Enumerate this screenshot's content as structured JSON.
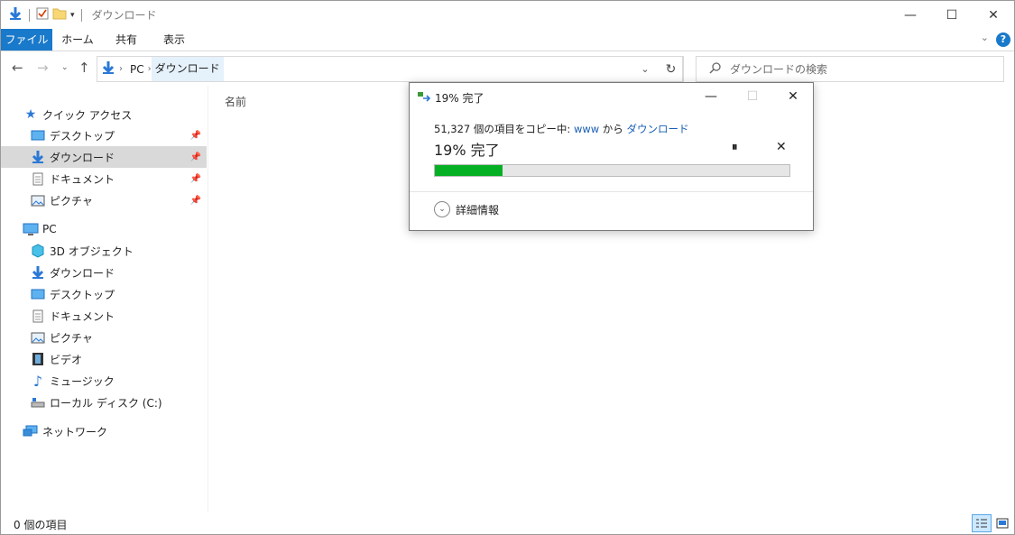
{
  "window": {
    "title": "ダウンロード",
    "controls": [
      "minimize",
      "maximize",
      "close"
    ]
  },
  "ribbon": {
    "tabs": [
      "ファイル",
      "ホーム",
      "共有",
      "表示"
    ],
    "help": "?"
  },
  "address": {
    "crumbs": [
      "PC",
      "ダウンロード"
    ],
    "search_placeholder": "ダウンロードの検索"
  },
  "sidebar": {
    "quick_access": {
      "label": "クイック アクセス",
      "items": [
        "デスクトップ",
        "ダウンロード",
        "ドキュメント",
        "ピクチャ"
      ]
    },
    "pc": {
      "label": "PC",
      "items": [
        "3D オブジェクト",
        "ダウンロード",
        "デスクトップ",
        "ドキュメント",
        "ピクチャ",
        "ビデオ",
        "ミュージック",
        "ローカル ディスク (C:)"
      ]
    },
    "network": {
      "label": "ネットワーク"
    }
  },
  "content": {
    "column_header": "名前"
  },
  "status": {
    "item_count": "0 個の項目"
  },
  "copy_dialog": {
    "title": "19% 完了",
    "desc_prefix": "51,327 個の項目をコピー中: ",
    "source": "www",
    "desc_mid": " から ",
    "destination": "ダウンロード",
    "percent_text": "19% 完了",
    "progress": 0.19,
    "more_details": "詳細情報"
  },
  "colors": {
    "accent": "#1979ca",
    "progress": "#06b025",
    "selected_nav": "#d9d9d9",
    "link": "#1a5fb4"
  }
}
